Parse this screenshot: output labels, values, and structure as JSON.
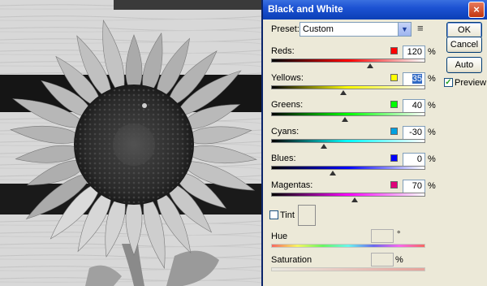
{
  "dialog": {
    "title": "Black and White",
    "close_glyph": "×",
    "preset": {
      "label": "Preset:",
      "value": "Custom",
      "menu_icon": "≡"
    },
    "buttons": {
      "ok": "OK",
      "cancel": "Cancel",
      "auto": "Auto"
    },
    "preview": {
      "label": "Preview",
      "checked": true,
      "check_glyph": "✓"
    },
    "sliders": [
      {
        "name": "Reds:",
        "value": "120",
        "unit": "%",
        "color": "#ff0000",
        "track_end": "#ff0000",
        "level": 120,
        "min": -200,
        "max": 300
      },
      {
        "name": "Yellows:",
        "value": "35",
        "unit": "%",
        "color": "#ffff00",
        "track_end": "#ffff00",
        "level": 35,
        "min": -200,
        "max": 300
      },
      {
        "name": "Greens:",
        "value": "40",
        "unit": "%",
        "color": "#00ff00",
        "track_end": "#00ff00",
        "level": 40,
        "min": -200,
        "max": 300
      },
      {
        "name": "Cyans:",
        "value": "-30",
        "unit": "%",
        "color": "#00a0e0",
        "track_end": "#00ffff",
        "level": -30,
        "min": -200,
        "max": 300
      },
      {
        "name": "Blues:",
        "value": "0",
        "unit": "%",
        "color": "#0000ff",
        "track_end": "#0000ff",
        "level": 0,
        "min": -200,
        "max": 300
      },
      {
        "name": "Magentas:",
        "value": "70",
        "unit": "%",
        "color": "#e0007a",
        "track_end": "#ff00ff",
        "level": 70,
        "min": -200,
        "max": 300
      }
    ],
    "tint": {
      "label": "Tint",
      "checked": false
    },
    "hue": {
      "label": "Hue",
      "unit": "°"
    },
    "saturation": {
      "label": "Saturation",
      "unit": "%"
    }
  }
}
